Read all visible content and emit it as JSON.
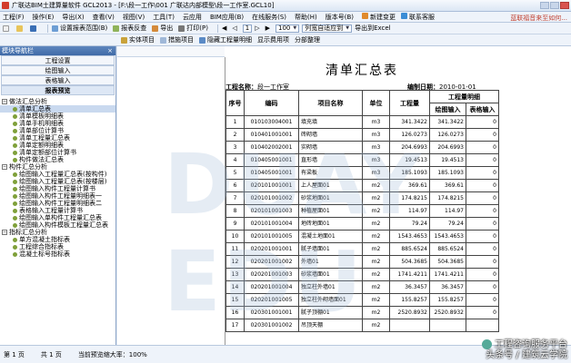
{
  "title_bar": {
    "text": "广联达BIM土建算量软件 GCL2013 - [F:\\段一工作\\001 广联达内部模型\\段一工作室.GCL10]"
  },
  "menubar": {
    "items": [
      "工程(F)",
      "操作(E)",
      "导出(X)",
      "查看(V)",
      "视图(V)",
      "工具(T)",
      "云应用",
      "BIM应用(B)",
      "在线服务(S)",
      "帮助(H)",
      "版本号(B)"
    ],
    "accent_items": [
      "新建变更",
      "联系客服"
    ],
    "notice": "蓝联福音来至如何..."
  },
  "toolbar1": {
    "items": [
      "设置报表范围(B)",
      "报表反查",
      "导出",
      "打印(P)"
    ],
    "zoom": "100",
    "fit": "列宽自适应到",
    "page": "1",
    "export_excel": "导出到Excel"
  },
  "toolbar2": {
    "items": [
      "实体项目",
      "措施项目",
      "隐藏工程量明细",
      "显示费用项",
      "分部整理"
    ]
  },
  "left_panel": {
    "title": "模块导航栏",
    "buttons": [
      "工程设置",
      "绘图输入",
      "表格输入",
      "报表预览"
    ],
    "groups": [
      {
        "label": "做法汇总分析",
        "items": [
          "清单汇总表",
          "清单模板明细表",
          "清单手机明细表",
          "清单部位计算书",
          "清单工程量汇总表",
          "清单定额明细表",
          "清单定额部位计算书",
          "构件做法汇总表"
        ]
      },
      {
        "label": "构件汇总分析",
        "items": [
          "绘图输入工程量汇总表(按构件)",
          "绘图输入工程量汇总表(按楼层)",
          "绘图输入构件工程量计算书",
          "绘图输入构件工程量明细表一",
          "绘图输入构件工程量明细表二",
          "表格输入工程量计算书",
          "绘图输入单构件工程量汇总表",
          "绘图输入构件模板工程量汇总表"
        ]
      },
      {
        "label": "指标汇总分析",
        "items": [
          "单方混凝土指标表",
          "工程综合指标表",
          "混凝土标号指标表"
        ]
      }
    ]
  },
  "report": {
    "title": "清单汇总表",
    "project_label": "工程名称：",
    "project_name": "段一工作室",
    "date_label": "编制日期：",
    "date": "2010-01-01",
    "headers": {
      "seq": "序号",
      "code": "编码",
      "name": "项目名称",
      "unit": "单位",
      "qty": "工程量",
      "detail": "工程量明细",
      "draw": "绘图输入",
      "table": "表格输入"
    },
    "rows": [
      {
        "seq": "1",
        "code": "010103004001",
        "name": "填充填",
        "unit": "m3",
        "qty": "341.3422",
        "draw": "341.3422",
        "table": "0"
      },
      {
        "seq": "2",
        "code": "010401001001",
        "name": "砖砌墙",
        "unit": "m3",
        "qty": "126.0273",
        "draw": "126.0273",
        "table": "0"
      },
      {
        "seq": "3",
        "code": "010402002001",
        "name": "实砌墙",
        "unit": "m3",
        "qty": "204.6993",
        "draw": "204.6993",
        "table": "0"
      },
      {
        "seq": "4",
        "code": "010405001001",
        "name": "直形墙",
        "unit": "m3",
        "qty": "19.4513",
        "draw": "19.4513",
        "table": "0"
      },
      {
        "seq": "5",
        "code": "010405001001",
        "name": "有梁板",
        "unit": "m3",
        "qty": "185.1093",
        "draw": "185.1093",
        "table": "0"
      },
      {
        "seq": "6",
        "code": "020101001001",
        "name": "上人屋面01",
        "unit": "m2",
        "qty": "369.61",
        "draw": "369.61",
        "table": "0"
      },
      {
        "seq": "7",
        "code": "020101001002",
        "name": "砂浆地面01",
        "unit": "m2",
        "qty": "174.8215",
        "draw": "174.8215",
        "table": "0"
      },
      {
        "seq": "8",
        "code": "020101001003",
        "name": "种植屋面01",
        "unit": "m2",
        "qty": "114.97",
        "draw": "114.97",
        "table": "0"
      },
      {
        "seq": "9",
        "code": "020101001004",
        "name": "地砖地面01",
        "unit": "m2",
        "qty": "79.24",
        "draw": "79.24",
        "table": "0"
      },
      {
        "seq": "10",
        "code": "020101001005",
        "name": "混凝土地面01",
        "unit": "m2",
        "qty": "1543.4653",
        "draw": "1543.4653",
        "table": "0"
      },
      {
        "seq": "11",
        "code": "020201001001",
        "name": "腻子墙面01",
        "unit": "m2",
        "qty": "885.6524",
        "draw": "885.6524",
        "table": "0"
      },
      {
        "seq": "12",
        "code": "020201001002",
        "name": "外墙01",
        "unit": "m2",
        "qty": "504.3685",
        "draw": "504.3685",
        "table": "0"
      },
      {
        "seq": "13",
        "code": "020201001003",
        "name": "砂浆墙面01",
        "unit": "m2",
        "qty": "1741.4211",
        "draw": "1741.4211",
        "table": "0"
      },
      {
        "seq": "14",
        "code": "020201001004",
        "name": "独立柱外墙01",
        "unit": "m2",
        "qty": "36.3457",
        "draw": "36.3457",
        "table": "0"
      },
      {
        "seq": "15",
        "code": "020201001005",
        "name": "独立柱外砌墙面01",
        "unit": "m2",
        "qty": "155.8257",
        "draw": "155.8257",
        "table": "0"
      },
      {
        "seq": "16",
        "code": "020301001001",
        "name": "腻子顶棚01",
        "unit": "m2",
        "qty": "2520.8932",
        "draw": "2520.8932",
        "table": "0"
      },
      {
        "seq": "17",
        "code": "020301001002",
        "name": "吊顶天棚",
        "unit": "m2",
        "qty": "",
        "draw": "",
        "table": ""
      }
    ]
  },
  "status_bar": {
    "page": "第 1 页",
    "total": "共 1 页",
    "zoom_text": "当前预览缩大率：100%"
  },
  "watermark": "DUAY EDU",
  "brand": {
    "line1": "工程咨询服务平台",
    "line2": "头条号 / 建筑云学院"
  }
}
